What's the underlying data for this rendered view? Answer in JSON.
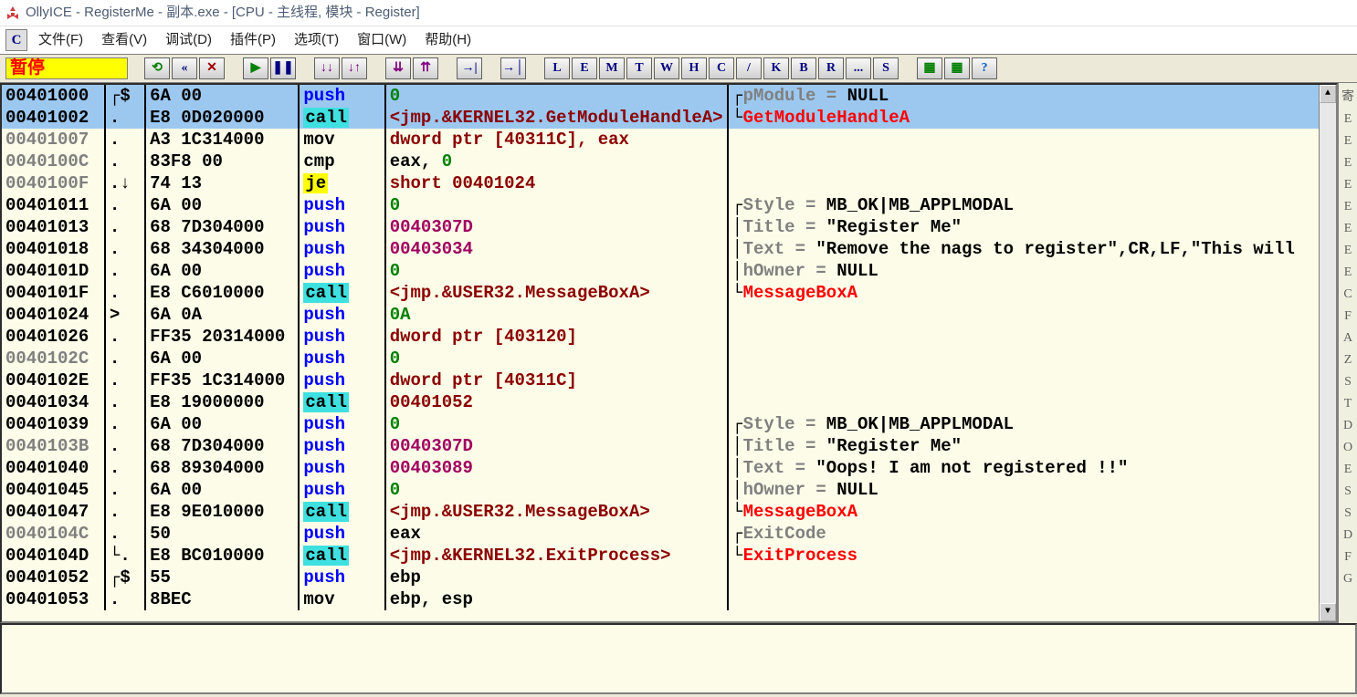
{
  "title": "OllyICE - RegisterMe - 副本.exe - [CPU - 主线程, 模块 - Register]",
  "menu": {
    "c": "C",
    "file": "文件(F)",
    "view": "查看(V)",
    "debug": "调试(D)",
    "plugins": "插件(P)",
    "options": "选项(T)",
    "window": "窗口(W)",
    "help": "帮助(H)"
  },
  "status": "暂停",
  "toolbar_letters": [
    "L",
    "E",
    "M",
    "T",
    "W",
    "H",
    "C",
    "/",
    "K",
    "B",
    "R",
    "...",
    "S"
  ],
  "rows": [
    {
      "sel": true,
      "addr": "00401000",
      "addrCls": "addr-black",
      "mark": "┌$",
      "hex": "6A 00",
      "mnem": "push",
      "mnemCls": "mnem-push",
      "op": [
        {
          "t": "0",
          "c": "op-imm"
        }
      ],
      "cmt": [
        {
          "b": "┌"
        },
        {
          "t": "pModule = ",
          "c": "cmt-key"
        },
        {
          "t": "NULL",
          "c": "cmt-val"
        }
      ]
    },
    {
      "sel": true,
      "addr": "00401002",
      "addrCls": "addr-black",
      "mark": ".",
      "hex": "E8 0D020000",
      "mnem": "call",
      "mnemCls": "mnem-call",
      "op": [
        {
          "t": "<jmp.&KERNEL32.GetModuleHandleA>",
          "c": "op-ref"
        }
      ],
      "cmt": [
        {
          "b": "└"
        },
        {
          "t": "GetModuleHandleA",
          "c": "cmt-api"
        }
      ]
    },
    {
      "addr": "00401007",
      "addrCls": "addr",
      "mark": ".",
      "hex": "A3 1C314000",
      "mnem": "mov",
      "mnemCls": "mnem-mov",
      "op": [
        {
          "t": "dword ptr [40311C], eax",
          "c": "op-bracket"
        }
      ],
      "cmt": []
    },
    {
      "addr": "0040100C",
      "addrCls": "addr",
      "mark": ".",
      "hex": "83F8 00",
      "mnem": "cmp",
      "mnemCls": "mnem-cmp",
      "op": [
        {
          "t": "eax, ",
          "c": "op-plain"
        },
        {
          "t": "0",
          "c": "op-imm"
        }
      ],
      "cmt": []
    },
    {
      "addr": "0040100F",
      "addrCls": "addr",
      "mark": ".↓",
      "hex": "74 13",
      "mnem": "je",
      "mnemCls": "mnem-je",
      "op": [
        {
          "t": "short 00401024",
          "c": "op-addr"
        }
      ],
      "cmt": []
    },
    {
      "addr": "00401011",
      "addrCls": "addr-black",
      "mark": ".",
      "hex": "6A 00",
      "mnem": "push",
      "mnemCls": "mnem-push",
      "op": [
        {
          "t": "0",
          "c": "op-imm"
        }
      ],
      "cmt": [
        {
          "b": "┌"
        },
        {
          "t": "Style = ",
          "c": "cmt-key"
        },
        {
          "t": "MB_OK|MB_APPLMODAL",
          "c": "cmt-val"
        }
      ]
    },
    {
      "addr": "00401013",
      "addrCls": "addr-black",
      "mark": ".",
      "hex": "68 7D304000",
      "mnem": "push",
      "mnemCls": "mnem-push",
      "op": [
        {
          "t": "0040307D",
          "c": "op-num"
        }
      ],
      "cmt": [
        {
          "b": "│"
        },
        {
          "t": "Title = ",
          "c": "cmt-key"
        },
        {
          "t": "\"Register Me\"",
          "c": "cmt-str"
        }
      ]
    },
    {
      "addr": "00401018",
      "addrCls": "addr-black",
      "mark": ".",
      "hex": "68 34304000",
      "mnem": "push",
      "mnemCls": "mnem-push",
      "op": [
        {
          "t": "00403034",
          "c": "op-num"
        }
      ],
      "cmt": [
        {
          "b": "│"
        },
        {
          "t": "Text = ",
          "c": "cmt-key"
        },
        {
          "t": "\"Remove the nags to register\",CR,LF,\"This will",
          "c": "cmt-str"
        }
      ]
    },
    {
      "addr": "0040101D",
      "addrCls": "addr-black",
      "mark": ".",
      "hex": "6A 00",
      "mnem": "push",
      "mnemCls": "mnem-push",
      "op": [
        {
          "t": "0",
          "c": "op-imm"
        }
      ],
      "cmt": [
        {
          "b": "│"
        },
        {
          "t": "hOwner = ",
          "c": "cmt-key"
        },
        {
          "t": "NULL",
          "c": "cmt-val"
        }
      ]
    },
    {
      "addr": "0040101F",
      "addrCls": "addr-black",
      "mark": ".",
      "hex": "E8 C6010000",
      "mnem": "call",
      "mnemCls": "mnem-call",
      "op": [
        {
          "t": "<jmp.&USER32.MessageBoxA>",
          "c": "op-ref"
        }
      ],
      "cmt": [
        {
          "b": "└"
        },
        {
          "t": "MessageBoxA",
          "c": "cmt-api"
        }
      ]
    },
    {
      "addr": "00401024",
      "addrCls": "addr-black",
      "mark": ">",
      "hex": "6A 0A",
      "mnem": "push",
      "mnemCls": "mnem-push",
      "op": [
        {
          "t": "0A",
          "c": "op-imm"
        }
      ],
      "cmt": []
    },
    {
      "addr": "00401026",
      "addrCls": "addr-black",
      "mark": ".",
      "hex": "FF35 20314000",
      "mnem": "push",
      "mnemCls": "mnem-push",
      "op": [
        {
          "t": "dword ptr [403120]",
          "c": "op-bracket"
        }
      ],
      "cmt": []
    },
    {
      "addr": "0040102C",
      "addrCls": "addr",
      "mark": ".",
      "hex": "6A 00",
      "mnem": "push",
      "mnemCls": "mnem-push",
      "op": [
        {
          "t": "0",
          "c": "op-imm"
        }
      ],
      "cmt": []
    },
    {
      "addr": "0040102E",
      "addrCls": "addr-black",
      "mark": ".",
      "hex": "FF35 1C314000",
      "mnem": "push",
      "mnemCls": "mnem-push",
      "op": [
        {
          "t": "dword ptr [40311C]",
          "c": "op-bracket"
        }
      ],
      "cmt": []
    },
    {
      "addr": "00401034",
      "addrCls": "addr-black",
      "mark": ".",
      "hex": "E8 19000000",
      "mnem": "call",
      "mnemCls": "mnem-call",
      "op": [
        {
          "t": "00401052",
          "c": "op-addr"
        }
      ],
      "cmt": []
    },
    {
      "addr": "00401039",
      "addrCls": "addr-black",
      "mark": ".",
      "hex": "6A 00",
      "mnem": "push",
      "mnemCls": "mnem-push",
      "op": [
        {
          "t": "0",
          "c": "op-imm"
        }
      ],
      "cmt": [
        {
          "b": "┌"
        },
        {
          "t": "Style = ",
          "c": "cmt-key"
        },
        {
          "t": "MB_OK|MB_APPLMODAL",
          "c": "cmt-val"
        }
      ]
    },
    {
      "addr": "0040103B",
      "addrCls": "addr",
      "mark": ".",
      "hex": "68 7D304000",
      "mnem": "push",
      "mnemCls": "mnem-push",
      "op": [
        {
          "t": "0040307D",
          "c": "op-num"
        }
      ],
      "cmt": [
        {
          "b": "│"
        },
        {
          "t": "Title = ",
          "c": "cmt-key"
        },
        {
          "t": "\"Register Me\"",
          "c": "cmt-str"
        }
      ]
    },
    {
      "addr": "00401040",
      "addrCls": "addr-black",
      "mark": ".",
      "hex": "68 89304000",
      "mnem": "push",
      "mnemCls": "mnem-push",
      "op": [
        {
          "t": "00403089",
          "c": "op-num"
        }
      ],
      "cmt": [
        {
          "b": "│"
        },
        {
          "t": "Text = ",
          "c": "cmt-key"
        },
        {
          "t": "\"Oops! I am not registered !!\"",
          "c": "cmt-str"
        }
      ]
    },
    {
      "addr": "00401045",
      "addrCls": "addr-black",
      "mark": ".",
      "hex": "6A 00",
      "mnem": "push",
      "mnemCls": "mnem-push",
      "op": [
        {
          "t": "0",
          "c": "op-imm"
        }
      ],
      "cmt": [
        {
          "b": "│"
        },
        {
          "t": "hOwner = ",
          "c": "cmt-key"
        },
        {
          "t": "NULL",
          "c": "cmt-val"
        }
      ]
    },
    {
      "addr": "00401047",
      "addrCls": "addr-black",
      "mark": ".",
      "hex": "E8 9E010000",
      "mnem": "call",
      "mnemCls": "mnem-call",
      "op": [
        {
          "t": "<jmp.&USER32.MessageBoxA>",
          "c": "op-ref"
        }
      ],
      "cmt": [
        {
          "b": "└"
        },
        {
          "t": "MessageBoxA",
          "c": "cmt-api"
        }
      ]
    },
    {
      "addr": "0040104C",
      "addrCls": "addr",
      "mark": ".",
      "hex": "50",
      "mnem": "push",
      "mnemCls": "mnem-push",
      "op": [
        {
          "t": "eax",
          "c": "op-plain"
        }
      ],
      "cmt": [
        {
          "b": "┌"
        },
        {
          "t": "ExitCode",
          "c": "cmt-key"
        }
      ]
    },
    {
      "addr": "0040104D",
      "addrCls": "addr-black",
      "mark": "└.",
      "hex": "E8 BC010000",
      "mnem": "call",
      "mnemCls": "mnem-call",
      "op": [
        {
          "t": "<jmp.&KERNEL32.ExitProcess>",
          "c": "op-ref"
        }
      ],
      "cmt": [
        {
          "b": "└"
        },
        {
          "t": "ExitProcess",
          "c": "cmt-api"
        }
      ]
    },
    {
      "addr": "00401052",
      "addrCls": "addr-black",
      "mark": "┌$",
      "hex": "55",
      "mnem": "push",
      "mnemCls": "mnem-push",
      "op": [
        {
          "t": "ebp",
          "c": "op-plain"
        }
      ],
      "cmt": []
    },
    {
      "addr": "00401053",
      "addrCls": "addr-black",
      "mark": ".",
      "hex": "8BEC",
      "mnem": "mov",
      "mnemCls": "mnem-mov",
      "op": [
        {
          "t": "ebp, esp",
          "c": "op-plain"
        }
      ],
      "cmt": []
    }
  ],
  "right_strip": [
    "寄",
    "E",
    "E",
    "E",
    "E",
    "E",
    "E",
    "E",
    "E",
    "C",
    "F",
    "A",
    "Z",
    "S",
    "T",
    "D",
    "O",
    "E",
    "S",
    "S",
    "D",
    "F",
    "G"
  ]
}
